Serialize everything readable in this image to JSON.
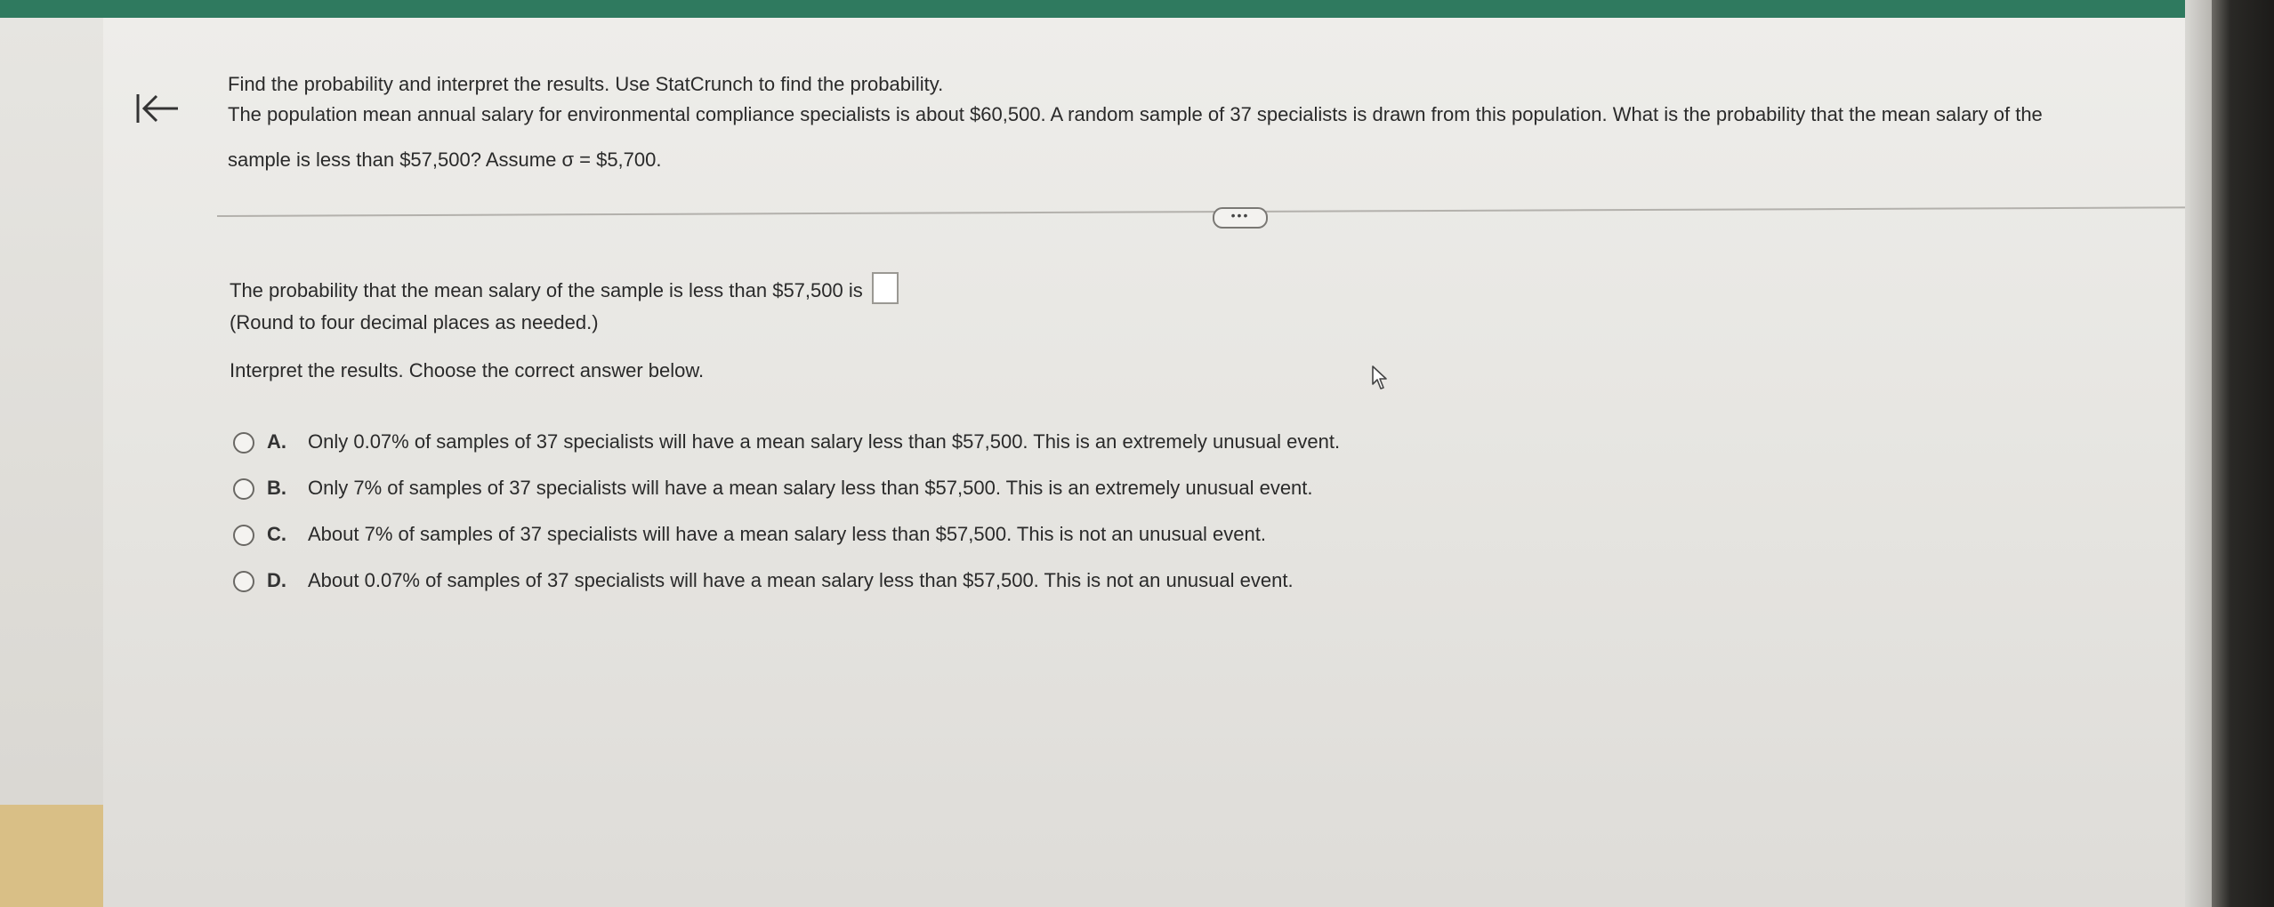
{
  "question": {
    "instruction": "Find the probability and interpret the results. Use StatCrunch to find the probability.",
    "prompt_line1": "The population mean annual salary for environmental compliance specialists is about $60,500. A random sample of 37 specialists is drawn from this population. What is the probability that the mean salary of the",
    "prompt_line2": "sample is less than $57,500? Assume σ = $5,700."
  },
  "toolbar": {
    "more_label": "•••"
  },
  "answer": {
    "text": "The probability that the mean salary of the sample is less than $57,500 is",
    "value": "",
    "round_note": "(Round to four decimal places as needed.)"
  },
  "interpret": {
    "prompt": "Interpret the results. Choose the correct answer below.",
    "options": [
      {
        "letter": "A.",
        "text": "Only 0.07% of samples of 37 specialists will have a mean salary less than $57,500. This is an extremely unusual event."
      },
      {
        "letter": "B.",
        "text": "Only 7% of samples of 37 specialists will have a mean salary less than $57,500. This is an extremely unusual event."
      },
      {
        "letter": "C.",
        "text": "About 7% of samples of 37 specialists will have a mean salary less than $57,500. This is not an unusual event."
      },
      {
        "letter": "D.",
        "text": "About 0.07% of samples of 37 specialists will have a mean salary less than $57,500. This is not an unusual event."
      }
    ]
  },
  "icons": {
    "back": "arrow-left-to-bar-icon",
    "cursor": "mouse-pointer-icon",
    "radio": "radio-unselected-icon"
  },
  "colors": {
    "top_bar": "#2f7a5f",
    "text": "#2a2a2a",
    "panel": "#eeedea"
  }
}
